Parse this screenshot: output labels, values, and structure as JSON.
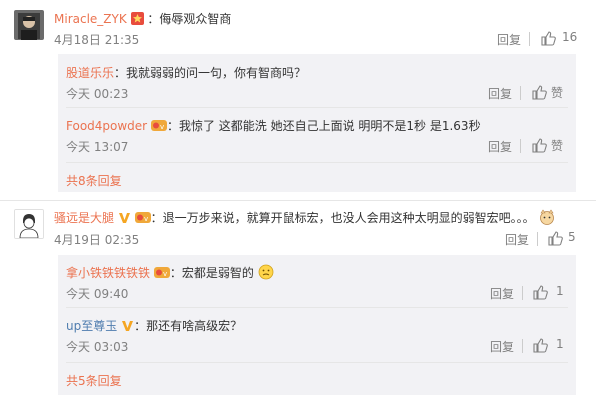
{
  "comments": [
    {
      "user": "Miracle_ZYK",
      "text": "：侮辱观众智商",
      "time": "4月18日 21:35",
      "reply_label": "回复",
      "like_count": "16",
      "replies": [
        {
          "user": "股道乐乐",
          "text": "：我就弱弱的问一句，你有智商吗？",
          "time": "今天 00:23",
          "reply_label": "回复",
          "like_label": "赞"
        },
        {
          "user": "Food4powder",
          "text": "：我惊了 这都能洗 她还自己上面说 明明不是1秒 是1.63秒",
          "time": "今天 13:07",
          "reply_label": "回复",
          "like_label": "赞"
        }
      ],
      "more_label": "共8条回复"
    },
    {
      "user": "骚远是大腿",
      "text": "：退一万步来说，就算开鼠标宏，也没人会用这种太明显的弱智宏吧。。。",
      "time": "4月19日 02:35",
      "reply_label": "回复",
      "like_count": "5",
      "replies": [
        {
          "user": "拿小铁铁铁铁铁",
          "text": "：宏都是弱智的",
          "time": "今天 09:40",
          "reply_label": "回复",
          "like_count": "1"
        },
        {
          "user": "up至尊玉",
          "text": "：那还有啥高级宏？",
          "time": "今天 03:03",
          "reply_label": "回复",
          "like_count": "1"
        }
      ],
      "more_label": "共5条回复"
    }
  ],
  "colors": {
    "name": "#eb7350",
    "accent_blue": "#507daf",
    "meta": "#808080",
    "reply_bg": "#f2f2f5"
  },
  "icons": [
    "thumb-up-icon",
    "verified-v-icon",
    "vip-badge-icon",
    "star-badge-icon",
    "emoji-icon"
  ]
}
